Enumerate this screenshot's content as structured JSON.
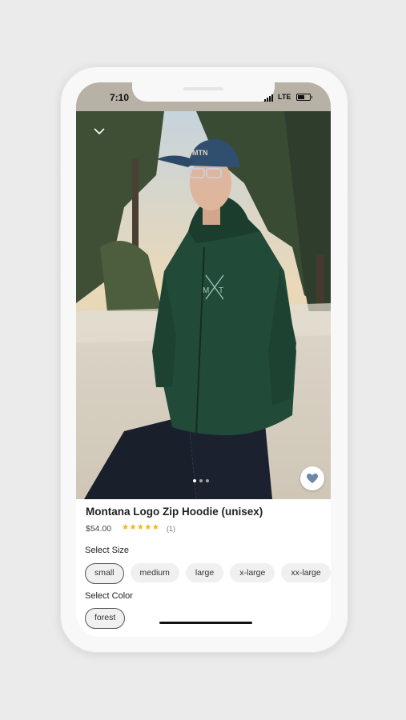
{
  "status_bar": {
    "time": "7:10",
    "network": "LTE"
  },
  "product": {
    "title": "Montana Logo Zip Hoodie (unisex)",
    "price": "$54.00",
    "stars": "★★★★★",
    "reviews": "(1)"
  },
  "gallery": {
    "slides": 3,
    "active_slide": 1
  },
  "size": {
    "label": "Select Size",
    "options": [
      "small",
      "medium",
      "large",
      "x-large",
      "xx-large"
    ],
    "selected": "small"
  },
  "color": {
    "label": "Select Color",
    "options": [
      "forest"
    ],
    "selected": "forest"
  },
  "colors": {
    "accent_star": "#f2b21a",
    "hoodie": "#214a38",
    "status_bar_bg": "#b7b1a6"
  }
}
